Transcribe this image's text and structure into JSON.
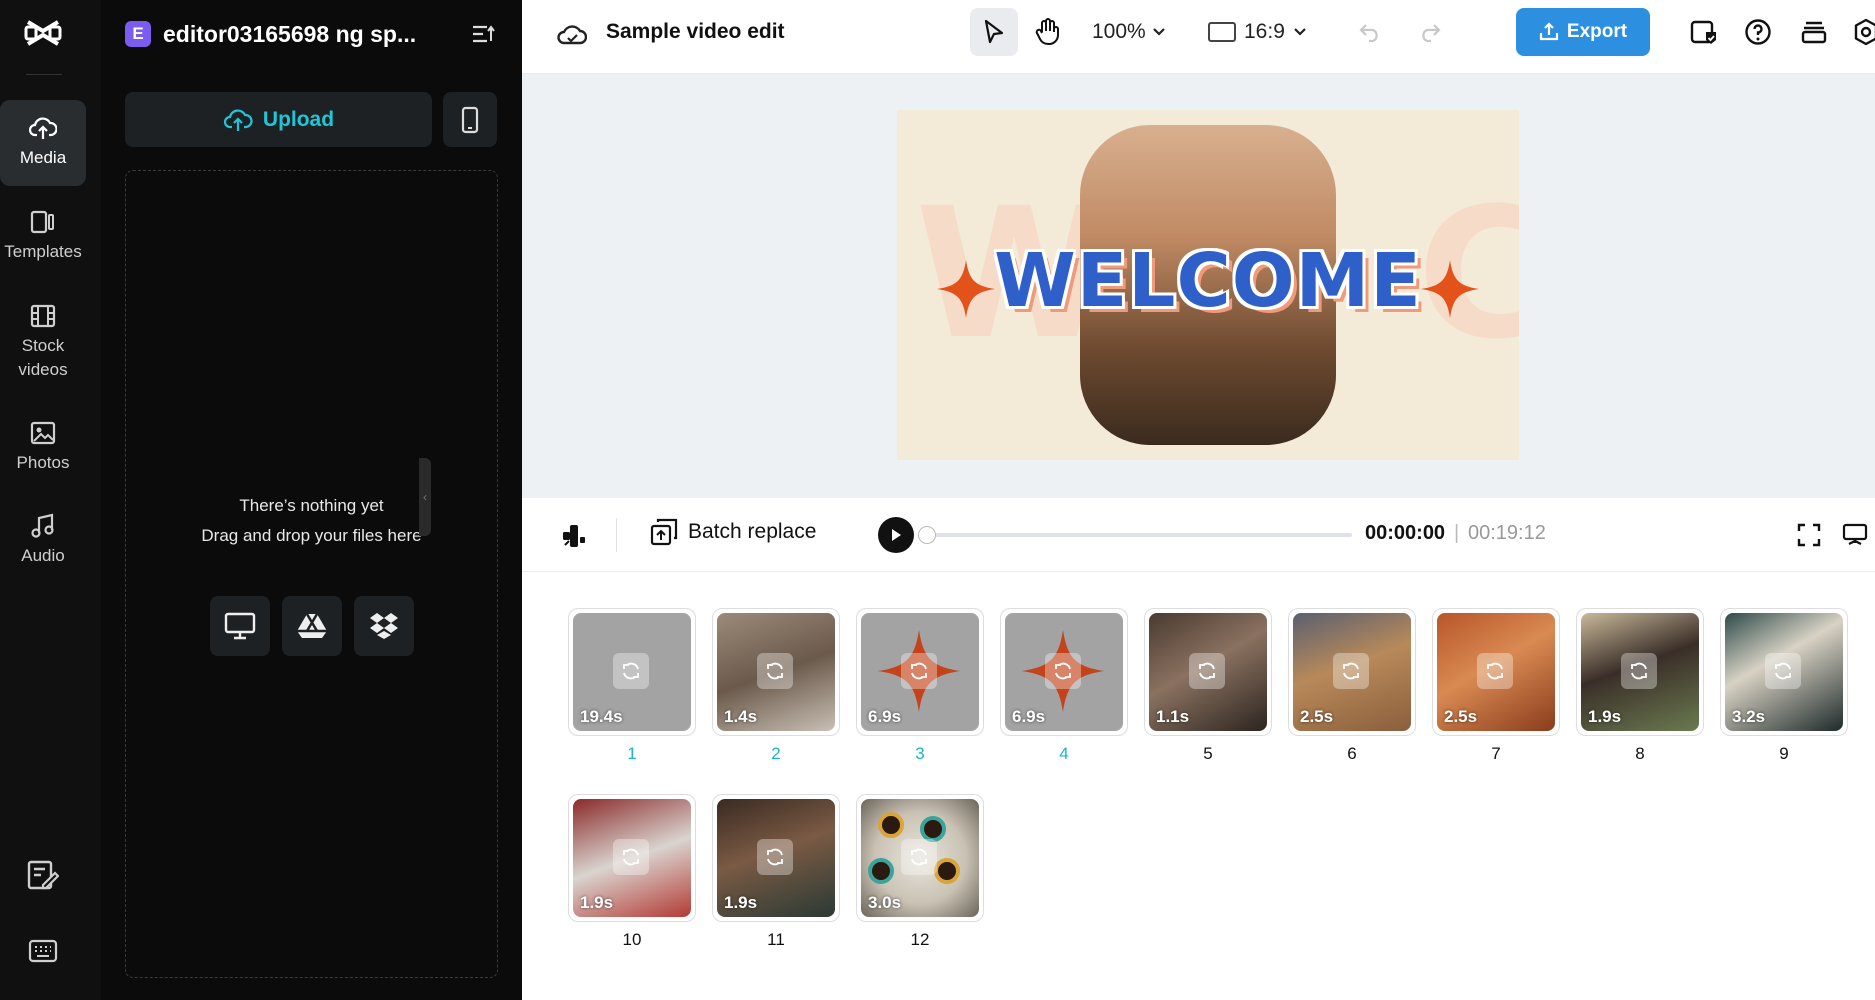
{
  "rail": {
    "items": [
      {
        "label": "Media",
        "icon": "cloud-upload-icon"
      },
      {
        "label": "Templates",
        "icon": "templates-icon"
      },
      {
        "label": "Stock videos",
        "icon": "film-icon"
      },
      {
        "label": "Photos",
        "icon": "image-icon"
      },
      {
        "label": "Audio",
        "icon": "music-note-icon"
      }
    ]
  },
  "panel": {
    "project_badge": "E",
    "project_name": "editor03165698 ng sp...",
    "upload_label": "Upload",
    "empty_line1": "There’s nothing yet",
    "empty_line2": "Drag and drop your files here"
  },
  "topbar": {
    "title": "Sample video edit",
    "zoom": "100%",
    "ratio": "16:9",
    "export_label": "Export"
  },
  "canvas": {
    "welcome_text": "WELCOME",
    "accent": "#e4521c",
    "text_color": "#2f5fc9"
  },
  "playbar": {
    "batch_label": "Batch replace",
    "time_current": "00:00:00",
    "time_separator": "|",
    "time_total": "00:19:12"
  },
  "scenes": [
    {
      "num": "1",
      "dur": "19.4s",
      "highlight": true
    },
    {
      "num": "2",
      "dur": "1.4s",
      "highlight": true
    },
    {
      "num": "3",
      "dur": "6.9s",
      "highlight": true
    },
    {
      "num": "4",
      "dur": "6.9s",
      "highlight": true
    },
    {
      "num": "5",
      "dur": "1.1s",
      "highlight": false
    },
    {
      "num": "6",
      "dur": "2.5s",
      "highlight": false
    },
    {
      "num": "7",
      "dur": "2.5s",
      "highlight": false
    },
    {
      "num": "8",
      "dur": "1.9s",
      "highlight": false
    },
    {
      "num": "9",
      "dur": "3.2s",
      "highlight": false
    },
    {
      "num": "10",
      "dur": "1.9s",
      "highlight": false
    },
    {
      "num": "11",
      "dur": "1.9s",
      "highlight": false
    },
    {
      "num": "12",
      "dur": "3.0s",
      "highlight": false
    }
  ]
}
